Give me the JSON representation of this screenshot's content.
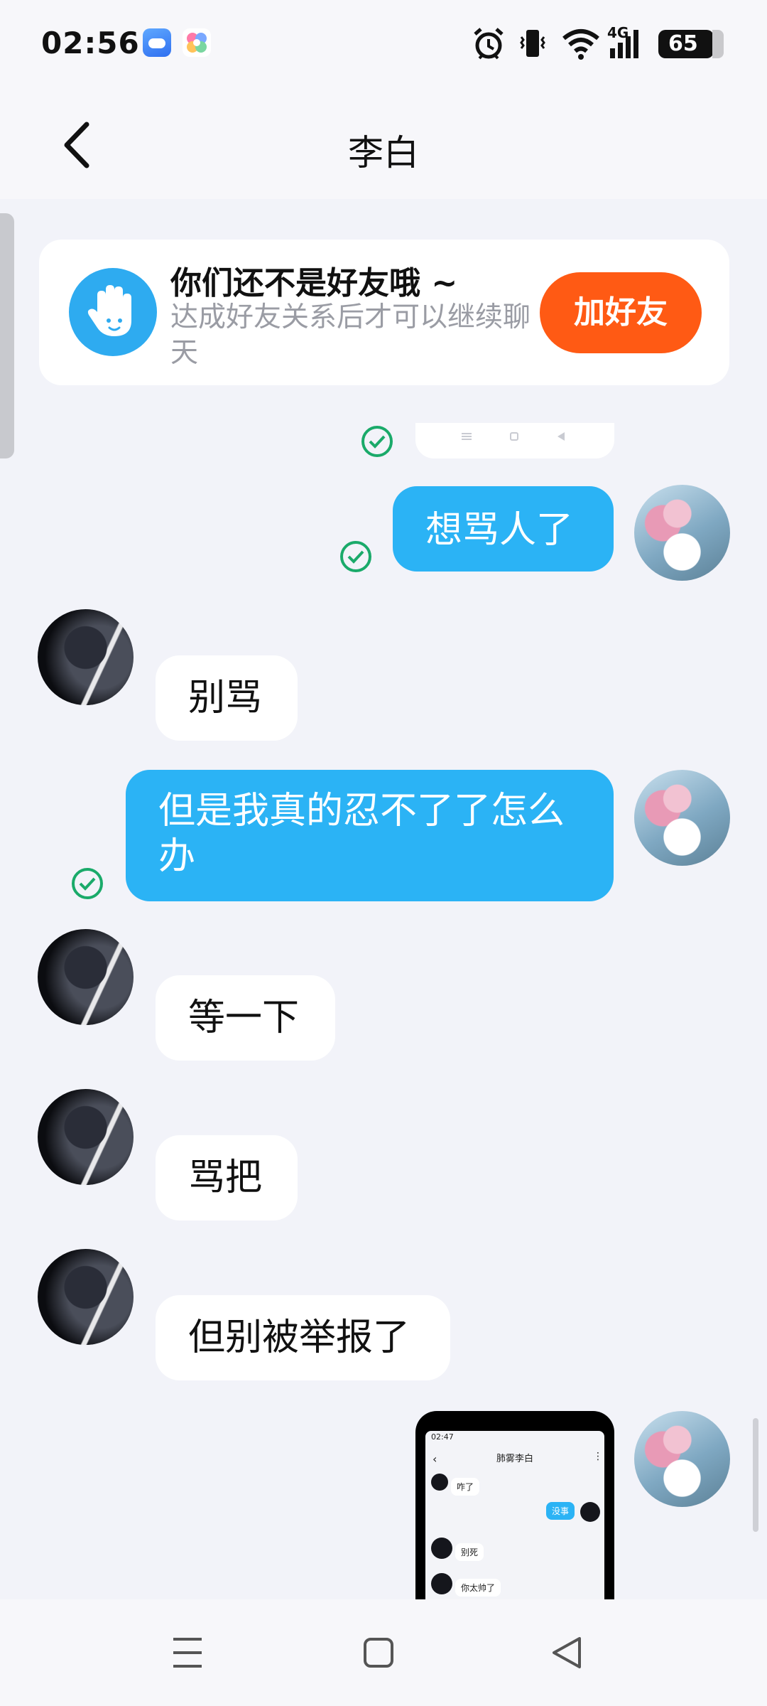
{
  "status_bar": {
    "time": "02:56",
    "network": "4G",
    "battery": "65",
    "icons": [
      "weather-app-icon",
      "flower-app-icon",
      "alarm-icon",
      "vibrate-icon",
      "wifi-icon",
      "signal-icon",
      "battery-icon"
    ]
  },
  "header": {
    "title": "李白",
    "back_icon": "chevron-left-icon"
  },
  "banner": {
    "title": "你们还不是好友哦 ~",
    "subtitle": "达成好友关系后才可以继续聊天",
    "button": "加好友",
    "accent": "#ff5a14"
  },
  "messages": [
    {
      "from": "self",
      "text": "想骂人了",
      "status": "read"
    },
    {
      "from": "other",
      "text": "别骂"
    },
    {
      "from": "self",
      "text": "但是我真的忍不了了怎么办",
      "status": "read"
    },
    {
      "from": "other",
      "text": "等一下"
    },
    {
      "from": "other",
      "text": "骂把"
    },
    {
      "from": "other",
      "text": "但别被举报了"
    },
    {
      "from": "self",
      "type": "image",
      "caption": "screenshot"
    }
  ],
  "screenshot_image": {
    "time": "02:47",
    "title": "肺雾李白",
    "lines": [
      "咋了",
      "没事",
      "别死",
      "你太帅了"
    ]
  },
  "colors": {
    "outgoing_bubble": "#2bb3f5",
    "incoming_bubble": "#ffffff",
    "read_check": "#1aaa6a",
    "background": "#f2f3f9"
  }
}
